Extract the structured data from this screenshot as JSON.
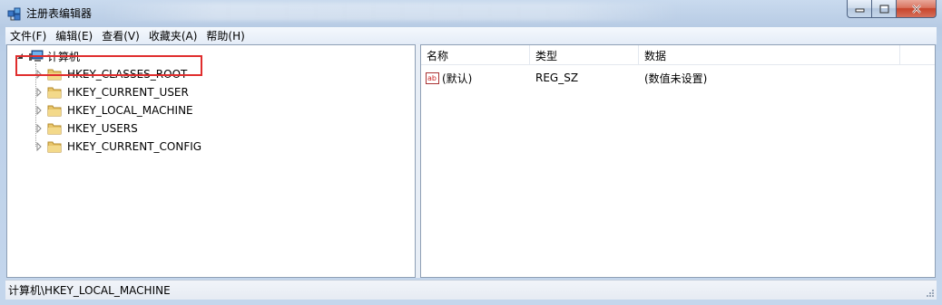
{
  "window": {
    "title": "注册表编辑器"
  },
  "menu": [
    {
      "label": "文件(F)"
    },
    {
      "label": "编辑(E)"
    },
    {
      "label": "查看(V)"
    },
    {
      "label": "收藏夹(A)"
    },
    {
      "label": "帮助(H)"
    }
  ],
  "tree": {
    "root_label": "计算机",
    "items": [
      {
        "label": "HKEY_CLASSES_ROOT"
      },
      {
        "label": "HKEY_CURRENT_USER"
      },
      {
        "label": "HKEY_LOCAL_MACHINE",
        "selected": true
      },
      {
        "label": "HKEY_USERS"
      },
      {
        "label": "HKEY_CURRENT_CONFIG"
      }
    ]
  },
  "list": {
    "columns": [
      "名称",
      "类型",
      "数据"
    ],
    "rows": [
      {
        "name": "(默认)",
        "type": "REG_SZ",
        "data": "(数值未设置)"
      }
    ]
  },
  "statusbar": {
    "path": "计算机\\HKEY_LOCAL_MACHINE"
  },
  "colors": {
    "highlight_border": "#e02d2d",
    "folder": "#e8c56a"
  }
}
